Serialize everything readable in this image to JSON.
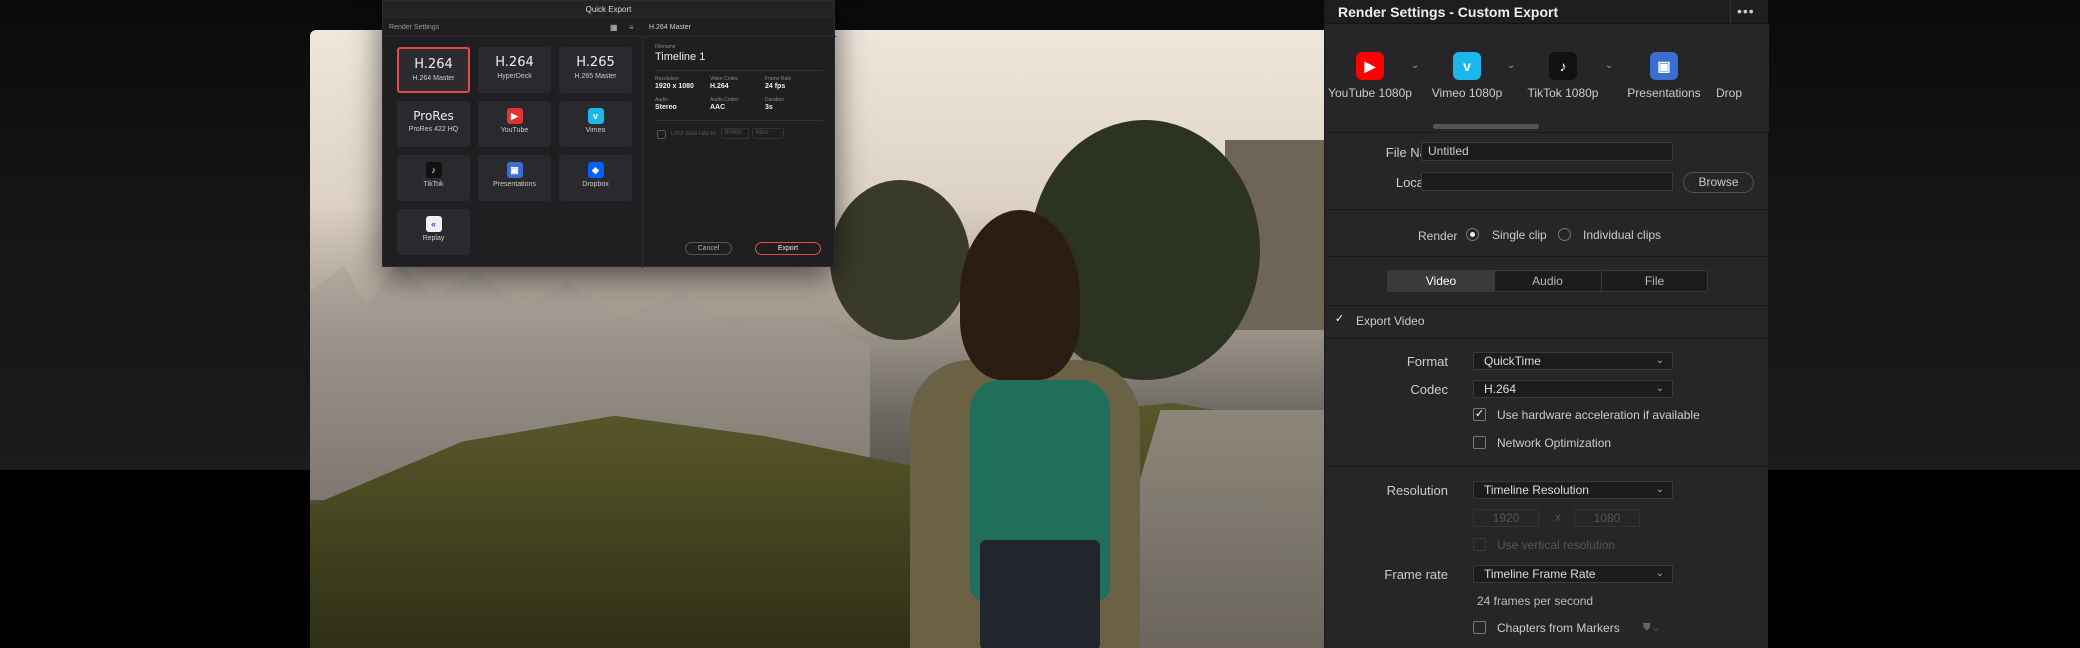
{
  "quick_export": {
    "title": "Quick Export",
    "subtitle": "Render Settings",
    "selected_preset": "H.264 Master",
    "presets": [
      {
        "big": "H.264",
        "label": "H.264 Master",
        "icon": null
      },
      {
        "big": "H.264",
        "label": "HyperDeck",
        "icon": null
      },
      {
        "big": "H.265",
        "label": "H.265 Master",
        "icon": null
      },
      {
        "big": "ProRes",
        "label": "ProRes 422 HQ",
        "icon": null
      },
      {
        "big": "",
        "label": "YouTube",
        "icon": "youtube-icon"
      },
      {
        "big": "",
        "label": "Vimeo",
        "icon": "vimeo-icon"
      },
      {
        "big": "",
        "label": "TikTok",
        "icon": "tiktok-icon"
      },
      {
        "big": "",
        "label": "Presentations",
        "icon": "presentations-icon"
      },
      {
        "big": "",
        "label": "Dropbox",
        "icon": "dropbox-icon"
      },
      {
        "big": "",
        "label": "Replay",
        "icon": "replay-icon"
      }
    ],
    "filename_label": "Filename",
    "filename": "Timeline 1",
    "meta": [
      {
        "key": "Resolution",
        "value": "1920 x 1080"
      },
      {
        "key": "Video Codec",
        "value": "H.264"
      },
      {
        "key": "Frame Rate",
        "value": "24 fps"
      },
      {
        "key": "Audio",
        "value": "Stereo"
      },
      {
        "key": "Audio Codec",
        "value": "AAC"
      },
      {
        "key": "Duration",
        "value": "3s"
      }
    ],
    "limit_label": "Limit data rate to",
    "limit_value": "80000",
    "limit_unit": "Kb/s",
    "cancel": "Cancel",
    "export": "Export"
  },
  "render_settings": {
    "title": "Render Settings - Custom Export",
    "more": "•••",
    "presets": [
      "YouTube 1080p",
      "Vimeo 1080p",
      "TikTok 1080p",
      "Presentations",
      "Drop"
    ],
    "file_name_label": "File Name",
    "file_name_value": "Untitled",
    "location_label": "Location",
    "location_value": "",
    "browse": "Browse",
    "render_label": "Render",
    "single_clip": "Single clip",
    "individual_clips": "Individual clips",
    "tabs": [
      "Video",
      "Audio",
      "File"
    ],
    "export_video": "Export Video",
    "format_label": "Format",
    "format_value": "QuickTime",
    "codec_label": "Codec",
    "codec_value": "H.264",
    "hw_accel": "Use hardware acceleration if available",
    "network_opt": "Network Optimization",
    "resolution_label": "Resolution",
    "resolution_value": "Timeline Resolution",
    "width": "1920",
    "height": "1080",
    "x": "x",
    "vertical_res": "Use vertical resolution",
    "frame_rate_label": "Frame rate",
    "frame_rate_value": "Timeline Frame Rate",
    "fps_text": "24 frames per second",
    "chapters": "Chapters from Markers"
  },
  "colors": {
    "accent_red": "#e24a4a",
    "youtube": "#ff0000",
    "vimeo": "#1ab7ea",
    "dropbox": "#0061fe",
    "panel": "#262628"
  }
}
